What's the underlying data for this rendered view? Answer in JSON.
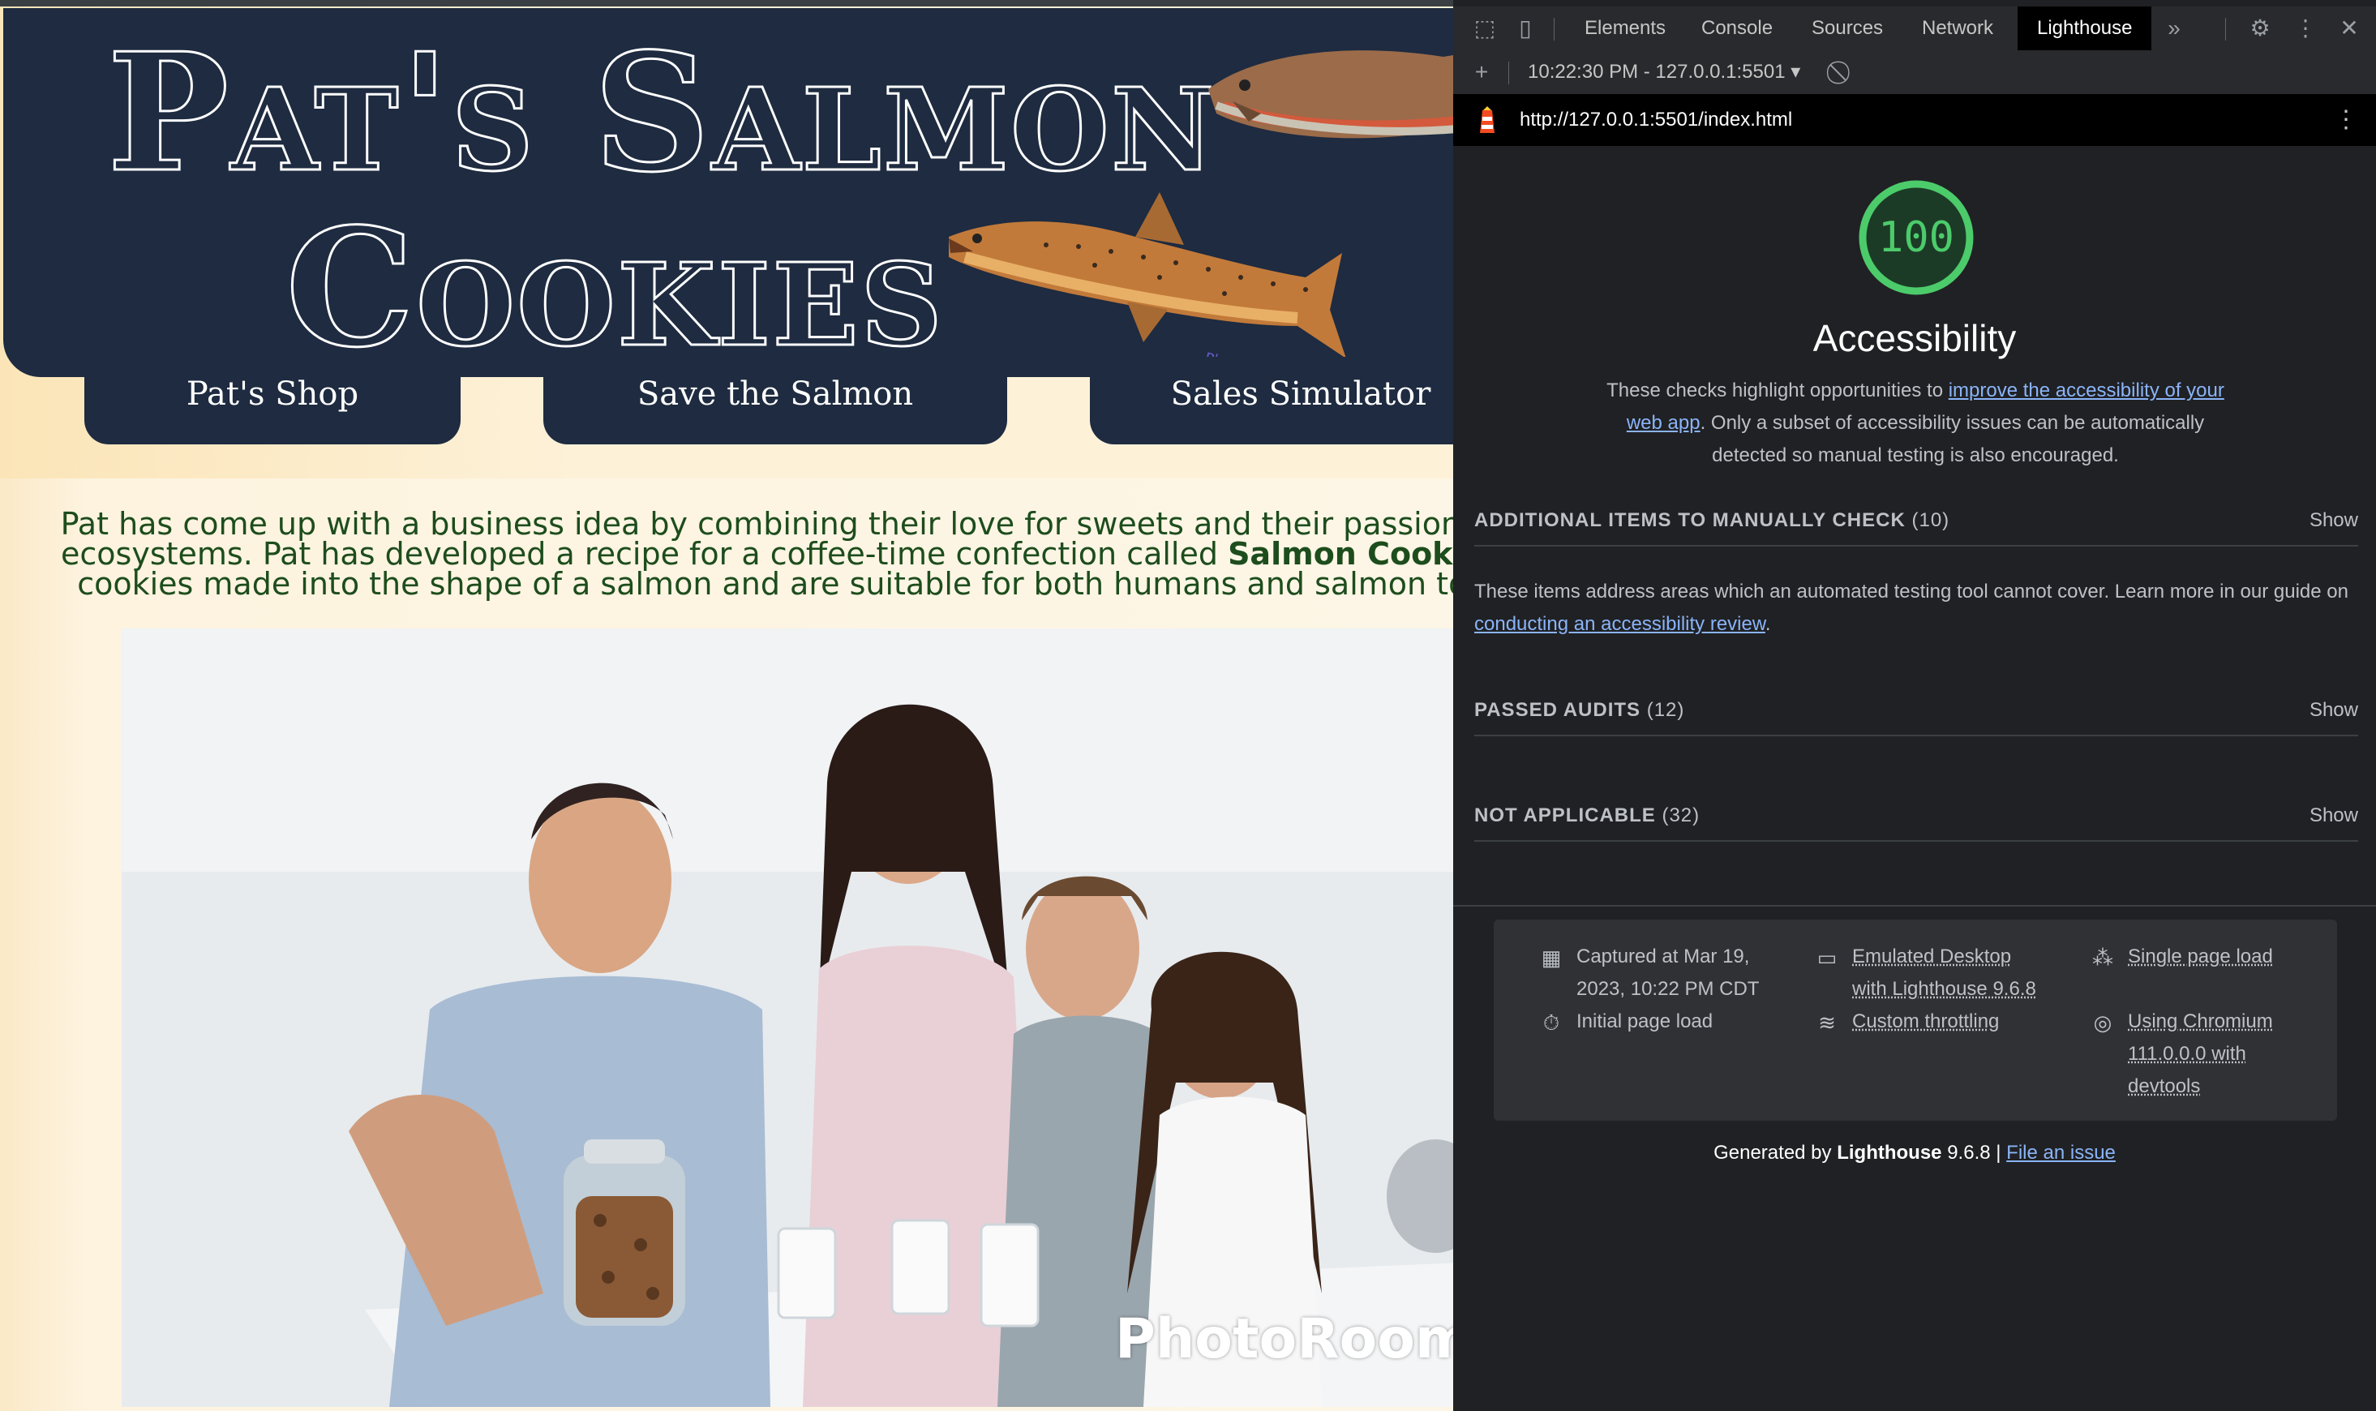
{
  "site": {
    "logo": {
      "line1": "Pat's Salmon",
      "line2": "Cookies"
    },
    "nav": [
      {
        "label": "Pat's Shop"
      },
      {
        "label": "Save the Salmon"
      },
      {
        "label": "Sales Simulator"
      }
    ],
    "fish_watermark": "PhotoRoom",
    "intro": {
      "line1": "Pat has come up with a business idea by combining their love for sweets and their passion for",
      "line2_pre": "ecosystems. Pat has developed a recipe for a coffee-time confection called ",
      "line2_bold": "Salmon Cookies",
      "line2_post": ".",
      "line3": "cookies made into the shape of a salmon and are suitable for both humans and salmon to e"
    },
    "photo_watermark": "PhotoRoom"
  },
  "devtools": {
    "tabs": [
      {
        "label": "Elements"
      },
      {
        "label": "Console"
      },
      {
        "label": "Sources"
      },
      {
        "label": "Network"
      },
      {
        "label": "Lighthouse"
      }
    ],
    "active_tab": "Lighthouse",
    "more_tabs": "»",
    "report_select": "10:22:30 PM - 127.0.0.1:5501 ▾",
    "url": "http://127.0.0.1:5501/index.html",
    "score": "100",
    "score_color": "#4ccb6b",
    "category_title": "Accessibility",
    "category_desc": {
      "pre": "These checks highlight opportunities to ",
      "link": "improve the accessibility of your web app",
      "post": ". Only a subset of accessibility issues can be automatically detected so manual testing is also encouraged."
    },
    "groups": {
      "manual": {
        "title": "ADDITIONAL ITEMS TO MANUALLY CHECK",
        "count": "(10)",
        "action": "Show"
      },
      "passed": {
        "title": "PASSED AUDITS",
        "count": "(12)",
        "action": "Show"
      },
      "na": {
        "title": "NOT APPLICABLE",
        "count": "(32)",
        "action": "Show"
      }
    },
    "manual_desc": {
      "pre": "These items address areas which an automated testing tool cannot cover. Learn more in our guide on ",
      "link": "conducting an accessibility review",
      "post": "."
    },
    "meta": {
      "captured_line1": "Captured at Mar 19,",
      "captured_line2": "2023, 10:22 PM CDT",
      "initial_load": "Initial page load",
      "emulated_line1": "Emulated Desktop",
      "emulated_line2": "with Lighthouse 9.6.8",
      "throttling": "Custom throttling",
      "single_load": "Single page load",
      "chromium_line1": "Using Chromium",
      "chromium_line2": "111.0.0.0 with",
      "chromium_line3": "devtools"
    },
    "footer": {
      "pre": "Generated by ",
      "bold": "Lighthouse",
      "version": " 9.6.8 | ",
      "link": "File an issue"
    }
  }
}
